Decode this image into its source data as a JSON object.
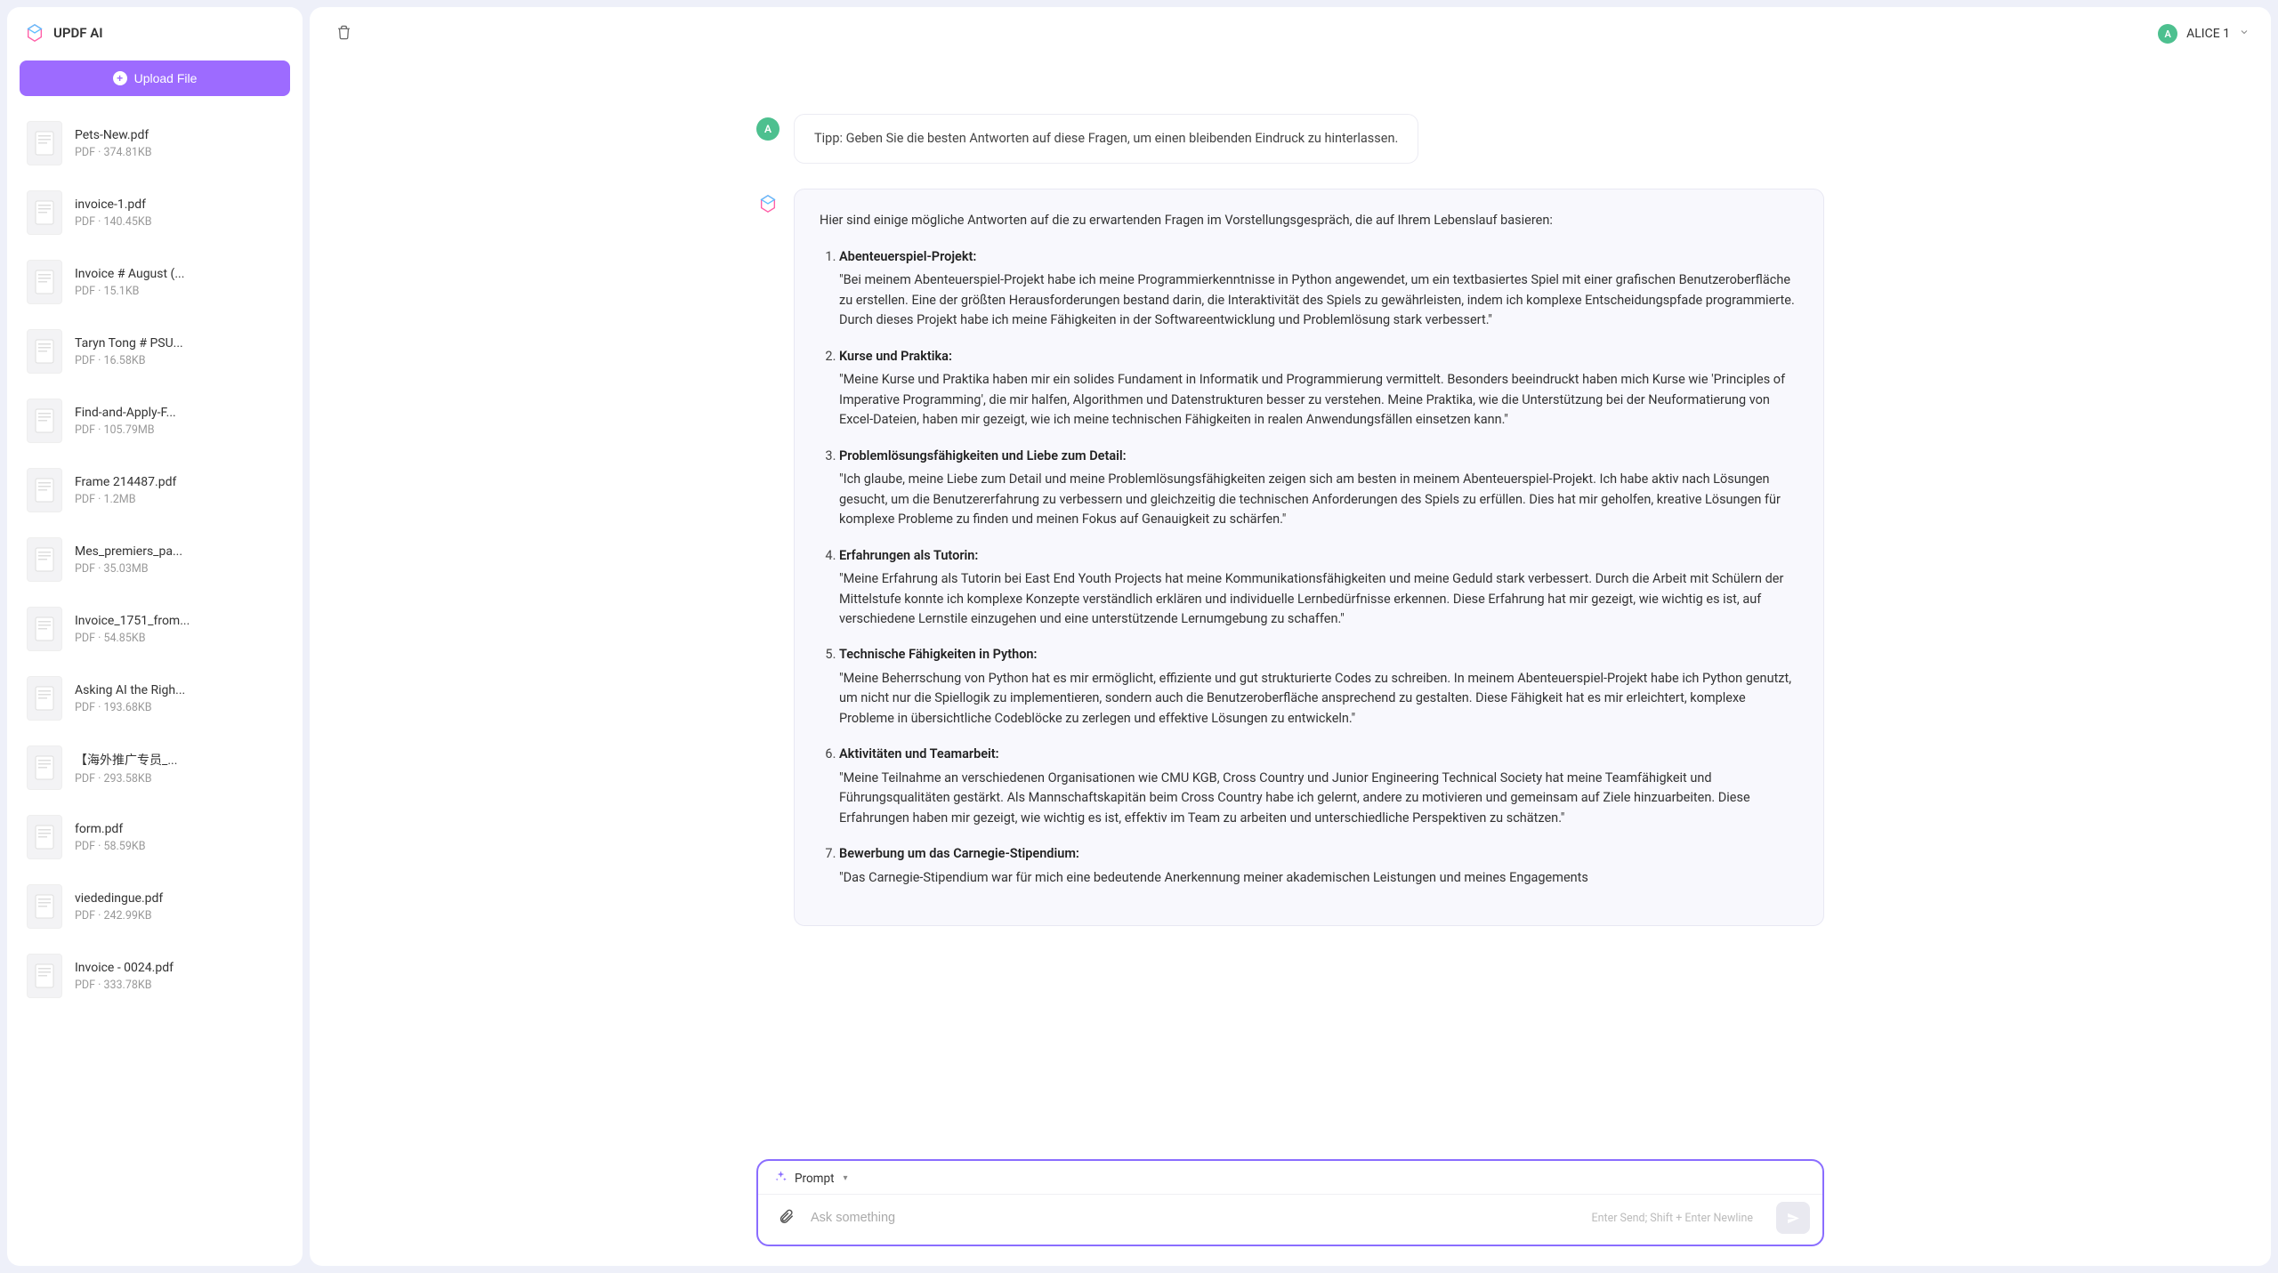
{
  "app": {
    "title": "UPDF AI",
    "upload_label": "Upload File"
  },
  "user": {
    "avatar_letter": "A",
    "name": "ALICE 1"
  },
  "sidebar": {
    "files": [
      {
        "name": "Pets-New.pdf",
        "meta": "PDF · 374.81KB"
      },
      {
        "name": "invoice-1.pdf",
        "meta": "PDF · 140.45KB"
      },
      {
        "name": "Invoice # August (...",
        "meta": "PDF · 15.1KB"
      },
      {
        "name": "Taryn Tong # PSU...",
        "meta": "PDF · 16.58KB"
      },
      {
        "name": "Find-and-Apply-F...",
        "meta": "PDF · 105.79MB"
      },
      {
        "name": "Frame 214487.pdf",
        "meta": "PDF · 1.2MB"
      },
      {
        "name": "Mes_premiers_pa...",
        "meta": "PDF · 35.03MB"
      },
      {
        "name": "Invoice_1751_from...",
        "meta": "PDF · 54.85KB"
      },
      {
        "name": "Asking AI the Righ...",
        "meta": "PDF · 193.68KB"
      },
      {
        "name": "【海外推广专员_...",
        "meta": "PDF · 293.58KB"
      },
      {
        "name": "form.pdf",
        "meta": "PDF · 58.59KB"
      },
      {
        "name": "viededingue.pdf",
        "meta": "PDF · 242.99KB"
      },
      {
        "name": "Invoice - 0024.pdf",
        "meta": "PDF · 333.78KB"
      }
    ]
  },
  "conversation": {
    "user_msg": "Tipp: Geben Sie die besten Antworten auf diese Fragen, um einen bleibenden Eindruck zu hinterlassen.",
    "ai_intro": "Hier sind einige mögliche Antworten auf die zu erwartenden Fragen im Vorstellungsgespräch, die auf Ihrem Lebenslauf basieren:",
    "ai_items": [
      {
        "title": "Abenteuerspiel-Projekt:",
        "body": "\"Bei meinem Abenteuerspiel-Projekt habe ich meine Programmierkenntnisse in Python angewendet, um ein textbasiertes Spiel mit einer grafischen Benutzeroberfläche zu erstellen. Eine der größten Herausforderungen bestand darin, die Interaktivität des Spiels zu gewährleisten, indem ich komplexe Entscheidungspfade programmierte. Durch dieses Projekt habe ich meine Fähigkeiten in der Softwareentwicklung und Problemlösung stark verbessert.\""
      },
      {
        "title": "Kurse und Praktika:",
        "body": "\"Meine Kurse und Praktika haben mir ein solides Fundament in Informatik und Programmierung vermittelt. Besonders beeindruckt haben mich Kurse wie 'Principles of Imperative Programming', die mir halfen, Algorithmen und Datenstrukturen besser zu verstehen. Meine Praktika, wie die Unterstützung bei der Neuformatierung von Excel-Dateien, haben mir gezeigt, wie ich meine technischen Fähigkeiten in realen Anwendungsfällen einsetzen kann.\""
      },
      {
        "title": "Problemlösungsfähigkeiten und Liebe zum Detail:",
        "body": "\"Ich glaube, meine Liebe zum Detail und meine Problemlösungsfähigkeiten zeigen sich am besten in meinem Abenteuerspiel-Projekt. Ich habe aktiv nach Lösungen gesucht, um die Benutzererfahrung zu verbessern und gleichzeitig die technischen Anforderungen des Spiels zu erfüllen. Dies hat mir geholfen, kreative Lösungen für komplexe Probleme zu finden und meinen Fokus auf Genauigkeit zu schärfen.\""
      },
      {
        "title": "Erfahrungen als Tutorin:",
        "body": "\"Meine Erfahrung als Tutorin bei East End Youth Projects hat meine Kommunikationsfähigkeiten und meine Geduld stark verbessert. Durch die Arbeit mit Schülern der Mittelstufe konnte ich komplexe Konzepte verständlich erklären und individuelle Lernbedürfnisse erkennen. Diese Erfahrung hat mir gezeigt, wie wichtig es ist, auf verschiedene Lernstile einzugehen und eine unterstützende Lernumgebung zu schaffen.\""
      },
      {
        "title": "Technische Fähigkeiten in Python:",
        "body": "\"Meine Beherrschung von Python hat es mir ermöglicht, effiziente und gut strukturierte Codes zu schreiben. In meinem Abenteuerspiel-Projekt habe ich Python genutzt, um nicht nur die Spiellogik zu implementieren, sondern auch die Benutzeroberfläche ansprechend zu gestalten. Diese Fähigkeit hat es mir erleichtert, komplexe Probleme in übersichtliche Codeblöcke zu zerlegen und effektive Lösungen zu entwickeln.\""
      },
      {
        "title": "Aktivitäten und Teamarbeit:",
        "body": "\"Meine Teilnahme an verschiedenen Organisationen wie CMU KGB, Cross Country und Junior Engineering Technical Society hat meine Teamfähigkeit und Führungsqualitäten gestärkt. Als Mannschaftskapitän beim Cross Country habe ich gelernt, andere zu motivieren und gemeinsam auf Ziele hinzuarbeiten. Diese Erfahrungen haben mir gezeigt, wie wichtig es ist, effektiv im Team zu arbeiten und unterschiedliche Perspektiven zu schätzen.\""
      },
      {
        "title": "Bewerbung um das Carnegie-Stipendium:",
        "body": "\"Das Carnegie-Stipendium war für mich eine bedeutende Anerkennung meiner akademischen Leistungen und meines Engagements"
      }
    ]
  },
  "input": {
    "prompt_label": "Prompt",
    "placeholder": "Ask something",
    "hint": "Enter Send; Shift + Enter Newline"
  }
}
